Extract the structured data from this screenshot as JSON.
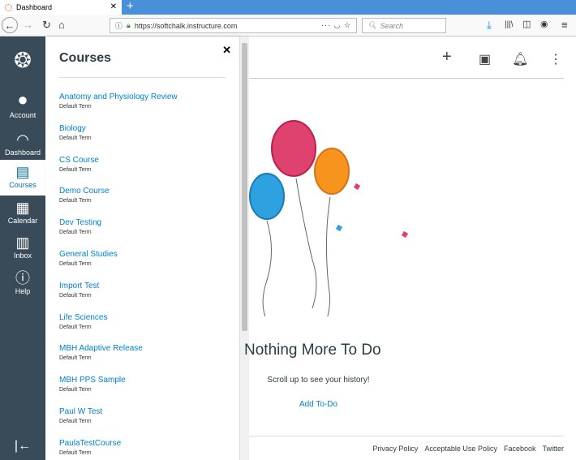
{
  "browser": {
    "tab_title": "Dashboard",
    "url": "https://softchalk.instructure.com",
    "search_placeholder": "Search"
  },
  "global_nav": [
    {
      "label": "Account",
      "icon": "avatar-icon"
    },
    {
      "label": "Dashboard",
      "icon": "dashboard-icon"
    },
    {
      "label": "Courses",
      "icon": "courses-icon",
      "active": true
    },
    {
      "label": "Calendar",
      "icon": "calendar-icon"
    },
    {
      "label": "Inbox",
      "icon": "inbox-icon"
    },
    {
      "label": "Help",
      "icon": "help-icon"
    }
  ],
  "tray": {
    "title": "Courses",
    "courses": [
      {
        "name": "Anatomy and Physiology Review",
        "term": "Default Term"
      },
      {
        "name": "Biology",
        "term": "Default Term"
      },
      {
        "name": "CS Course",
        "term": "Default Term"
      },
      {
        "name": "Demo Course",
        "term": "Default Term"
      },
      {
        "name": "Dev Testing",
        "term": "Default Term"
      },
      {
        "name": "General Studies",
        "term": "Default Term"
      },
      {
        "name": "Import Test",
        "term": "Default Term"
      },
      {
        "name": "Life Sciences",
        "term": "Default Term"
      },
      {
        "name": "MBH Adaptive Release",
        "term": "Default Term"
      },
      {
        "name": "MBH PPS Sample",
        "term": "Default Term"
      },
      {
        "name": "Paul W Test",
        "term": "Default Term"
      },
      {
        "name": "PaulaTestCourse",
        "term": "Default Term"
      }
    ]
  },
  "main": {
    "empty_title": "Nothing More To Do",
    "empty_sub": "Scroll up to see your history!",
    "add_todo": "Add To-Do"
  },
  "footer": [
    "Privacy Policy",
    "Acceptable Use Policy",
    "Facebook",
    "Twitter"
  ]
}
